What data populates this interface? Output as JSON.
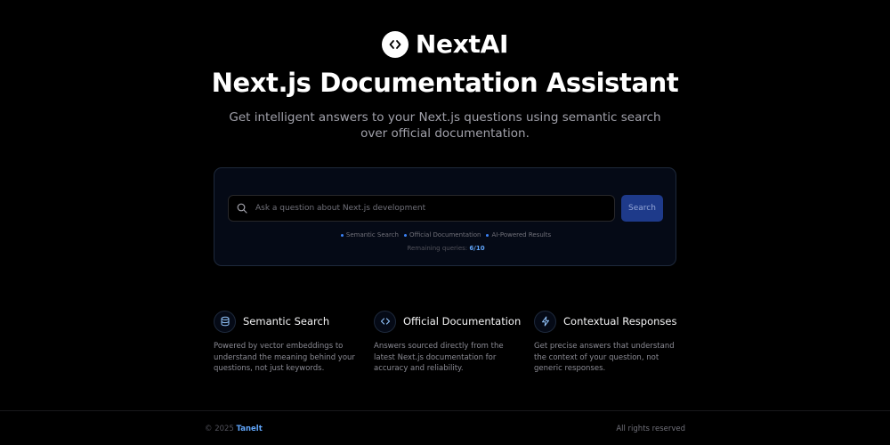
{
  "brand": {
    "name": "NextAI",
    "icon": "code-brackets-icon"
  },
  "hero": {
    "title": "Next.js Documentation Assistant",
    "subtitle": "Get intelligent answers to your Next.js questions using semantic search over official documentation."
  },
  "search": {
    "placeholder": "Ask a question about Next.js development",
    "value": "",
    "button_label": "Search",
    "tags": [
      "Semantic Search",
      "Official Documentation",
      "AI-Powered Results"
    ],
    "quota_label": "Remaining queries:",
    "quota_value": "6/10"
  },
  "features": [
    {
      "icon": "database-icon",
      "title": "Semantic Search",
      "description": "Powered by vector embeddings to understand the meaning behind your questions, not just keywords."
    },
    {
      "icon": "code-icon",
      "title": "Official Documentation",
      "description": "Answers sourced directly from the latest Next.js documentation for accuracy and reliability."
    },
    {
      "icon": "lightning-icon",
      "title": "Contextual Responses",
      "description": "Get precise answers that understand the context of your question, not generic responses."
    }
  ],
  "footer": {
    "copyright": "© 2025",
    "author": "Tanelt",
    "rights": "All rights reserved"
  },
  "colors": {
    "background": "#000000",
    "accent": "#3b82f6",
    "button": "#1e3a8a",
    "card": "#050a16"
  }
}
